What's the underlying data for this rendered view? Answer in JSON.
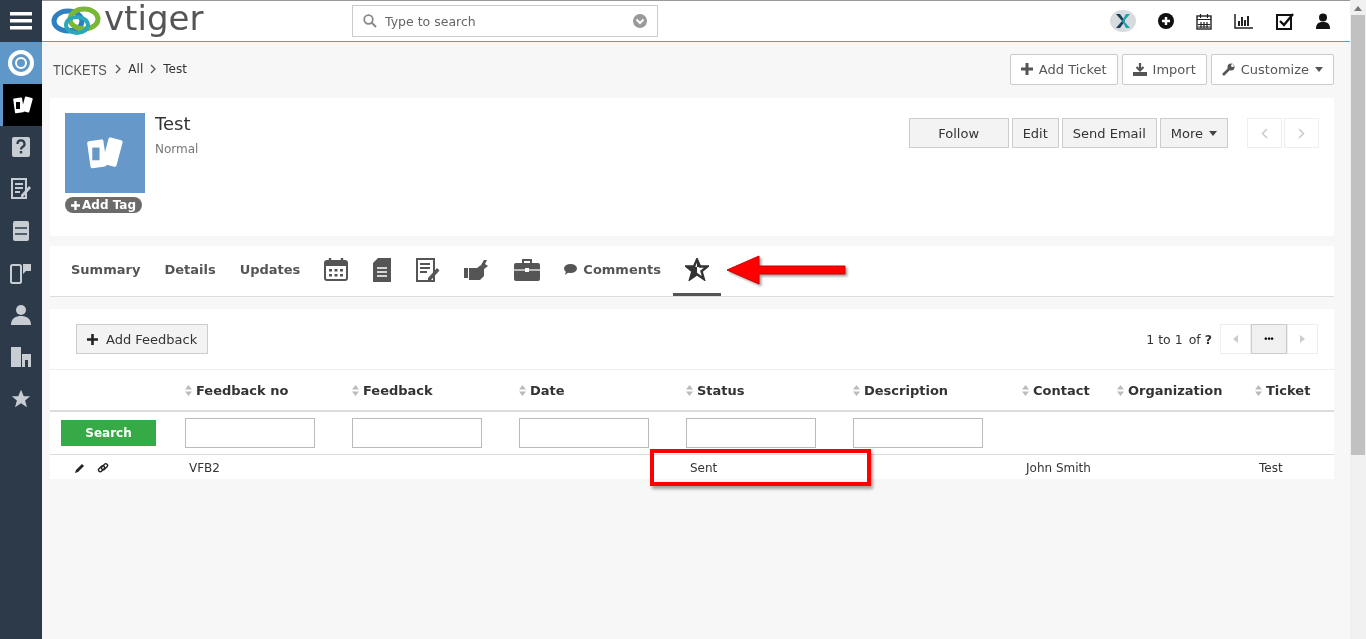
{
  "topbar": {
    "logo_text": "vtiger",
    "search": {
      "placeholder": "Type to search"
    }
  },
  "sidebar": {
    "items": [
      {
        "kind": "app",
        "selected": false
      },
      {
        "kind": "tickets",
        "selected": true
      },
      {
        "kind": "faq",
        "selected": false
      },
      {
        "kind": "form",
        "selected": false
      },
      {
        "kind": "cabinet",
        "selected": false
      },
      {
        "kind": "phone",
        "selected": false
      },
      {
        "kind": "person",
        "selected": false
      },
      {
        "kind": "building",
        "selected": false
      },
      {
        "kind": "star",
        "selected": false
      }
    ]
  },
  "breadcrumb": [
    "TICKETS",
    "All",
    "Test"
  ],
  "header_actions": [
    {
      "label": "Add Ticket",
      "kind": "plus"
    },
    {
      "label": "Import",
      "kind": "import"
    },
    {
      "label": "Customize",
      "kind": "wrench"
    }
  ],
  "record": {
    "title": "Test",
    "subtitle": "Normal",
    "add_tag": "Add Tag",
    "actions": [
      {
        "label": "Follow",
        "dropdown": false
      },
      {
        "label": "Edit",
        "dropdown": false
      },
      {
        "label": "Send Email",
        "dropdown": false
      },
      {
        "label": "More",
        "dropdown": true
      }
    ]
  },
  "tabs": [
    {
      "kind": "text",
      "label": "Summary",
      "selected": false
    },
    {
      "kind": "text",
      "label": "Details",
      "selected": false
    },
    {
      "kind": "text",
      "label": "Updates",
      "selected": false
    },
    {
      "kind": "calendar",
      "selected": false
    },
    {
      "kind": "document",
      "selected": false
    },
    {
      "kind": "note",
      "selected": false
    },
    {
      "kind": "handshake",
      "selected": false
    },
    {
      "kind": "briefcase",
      "selected": false
    },
    {
      "kind": "comments",
      "label": "Comments",
      "selected": false
    },
    {
      "kind": "star",
      "selected": true
    }
  ],
  "list": {
    "add_button": "Add Feedback",
    "pagination": {
      "range": "1 to 1",
      "of": "of",
      "total": "?",
      "more": "•••"
    },
    "search_button": "Search",
    "columns": [
      {
        "label": "Feedback no",
        "filter": true
      },
      {
        "label": "Feedback",
        "filter": true
      },
      {
        "label": "Date",
        "filter": true
      },
      {
        "label": "Status",
        "filter": true
      },
      {
        "label": "Description",
        "filter": true
      },
      {
        "label": "Contact",
        "filter": false
      },
      {
        "label": "Organization",
        "filter": false
      },
      {
        "label": "Ticket",
        "filter": false
      }
    ],
    "rows": [
      {
        "cells": [
          "VFB2",
          null,
          null,
          "Sent",
          null,
          "John Smith",
          null,
          "Test"
        ]
      }
    ]
  }
}
